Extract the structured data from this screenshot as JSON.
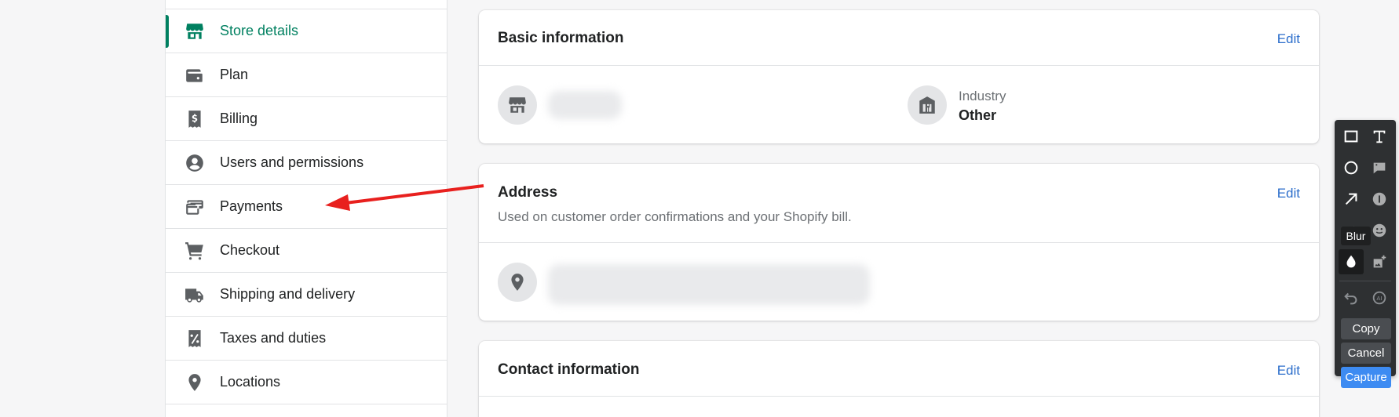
{
  "sidebar": {
    "items": [
      {
        "label": "Store details",
        "icon": "store-icon",
        "active": true
      },
      {
        "label": "Plan",
        "icon": "wallet-icon"
      },
      {
        "label": "Billing",
        "icon": "receipt-icon"
      },
      {
        "label": "Users and permissions",
        "icon": "user-circle-icon"
      },
      {
        "label": "Payments",
        "icon": "payments-icon"
      },
      {
        "label": "Checkout",
        "icon": "cart-icon"
      },
      {
        "label": "Shipping and delivery",
        "icon": "truck-icon"
      },
      {
        "label": "Taxes and duties",
        "icon": "tax-receipt-icon"
      },
      {
        "label": "Locations",
        "icon": "location-pin-icon"
      }
    ],
    "accent_color": "#008060"
  },
  "basic_info": {
    "title": "Basic information",
    "edit": "Edit",
    "industry_label": "Industry",
    "industry_value": "Other"
  },
  "address": {
    "title": "Address",
    "edit": "Edit",
    "subtitle": "Used on customer order confirmations and your Shopify bill."
  },
  "contact": {
    "title": "Contact information",
    "edit": "Edit"
  },
  "toolbar": {
    "tooltip": "Blur",
    "copy": "Copy",
    "cancel": "Cancel",
    "capture": "Capture",
    "tools": [
      "rectangle-icon",
      "text-icon",
      "ellipse-icon",
      "callout-icon",
      "arrow-icon",
      "number-icon",
      "pen-icon",
      "emoji-icon",
      "blur-drop-icon",
      "sticker-icon",
      "undo-icon",
      "ai-icon"
    ]
  },
  "colors": {
    "link": "#2c6ecb",
    "annotation_arrow": "#e8201e",
    "capture_button": "#3d8bf2"
  }
}
